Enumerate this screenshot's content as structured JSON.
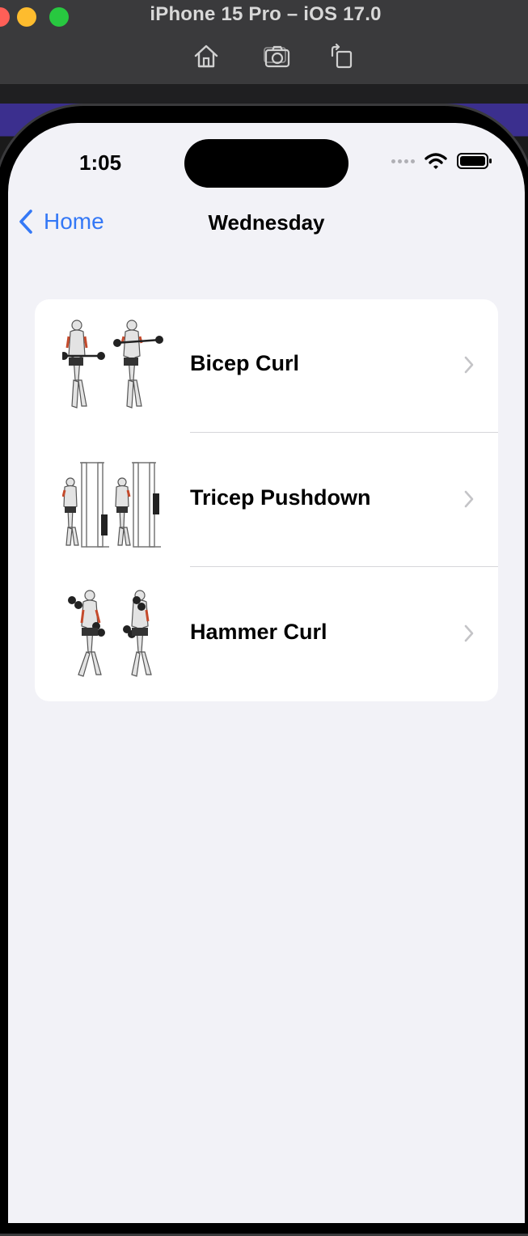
{
  "window": {
    "title": "iPhone 15 Pro – iOS 17.0",
    "toolbar": [
      {
        "icon": "home-icon"
      },
      {
        "icon": "screenshot-camera-icon"
      },
      {
        "icon": "rotate-icon"
      }
    ]
  },
  "status_bar": {
    "time": "1:05",
    "icons": [
      "cellular-dots-icon",
      "wifi-icon",
      "battery-icon"
    ]
  },
  "nav": {
    "back_label": "Home",
    "title": "Wednesday"
  },
  "exercises": [
    {
      "name": "Bicep Curl",
      "thumb_icon": "bicep-curl-illustration"
    },
    {
      "name": "Tricep Pushdown",
      "thumb_icon": "tricep-pushdown-illustration"
    },
    {
      "name": "Hammer Curl",
      "thumb_icon": "hammer-curl-illustration"
    }
  ],
  "colors": {
    "accent": "#3478f6",
    "background": "#f2f2f7",
    "card": "#ffffff",
    "chevron": "#c4c4c7"
  }
}
